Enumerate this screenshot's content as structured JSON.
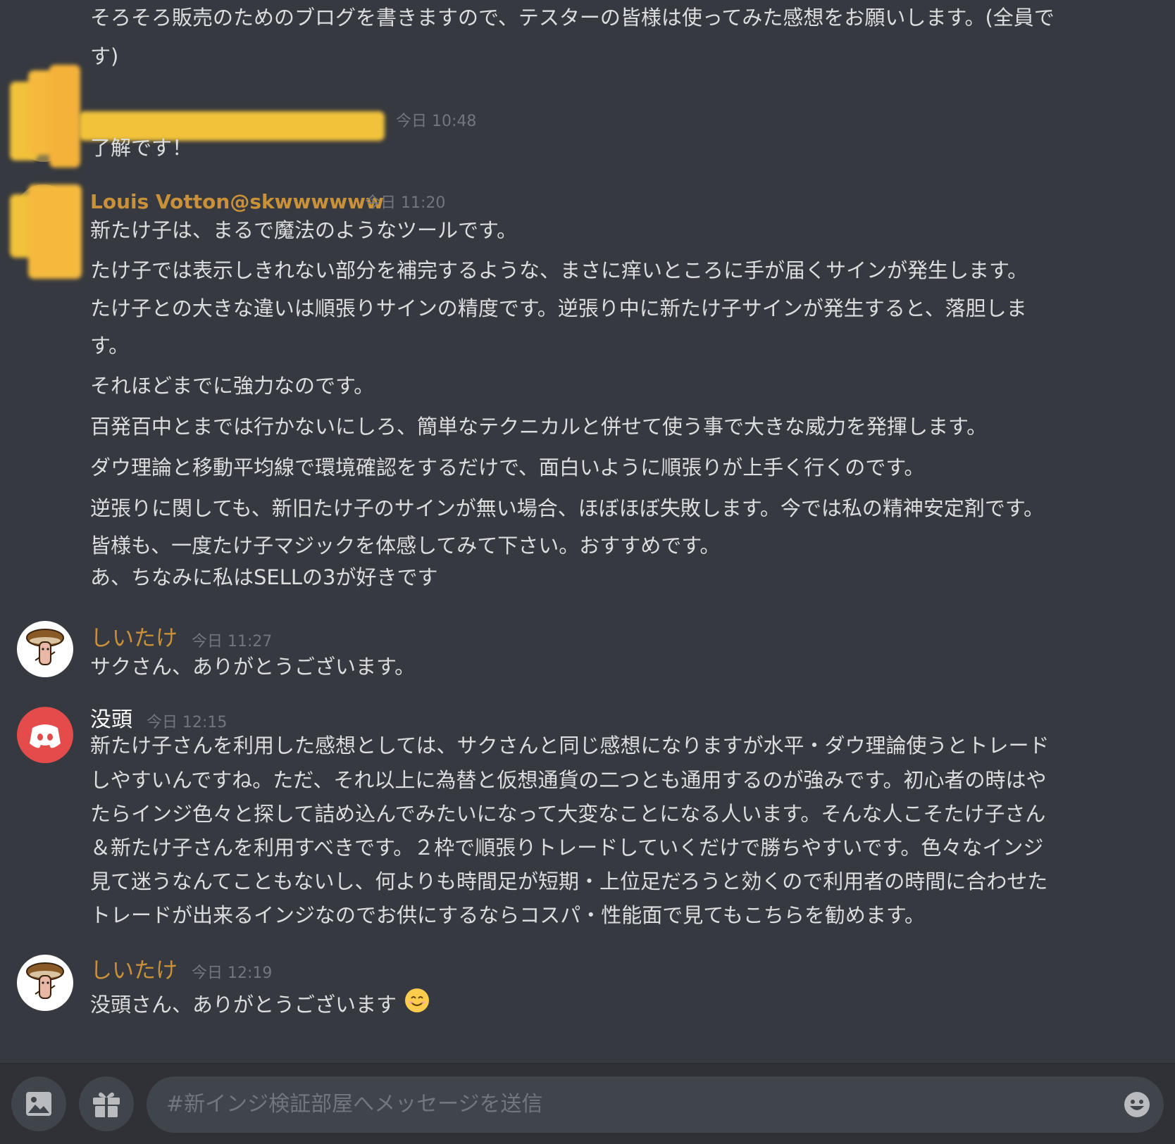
{
  "colors": {
    "background": "#36393f",
    "text": "#dcddde",
    "timestamp": "#72767d",
    "author_orange": "#c9913a",
    "discord_red": "#e44b4b",
    "input_bg": "#40444b",
    "bar_bg": "#2f3136"
  },
  "messages": {
    "m0": {
      "lines": [
        "そろそろ販売のためのブログを書きますので、テスターの皆様は使ってみた感想をお願いします。(全員で",
        "す)"
      ]
    },
    "m1": {
      "timestamp": "今日 10:48",
      "lines": [
        "了解です！"
      ]
    },
    "m2": {
      "author": "Louis Votton@skwwwwww",
      "timestamp": "今日 11:20",
      "lines": [
        "新たけ子は、まるで魔法のようなツールです。",
        "たけ子では表示しきれない部分を補完するような、まさに痒いところに手が届くサインが発生します。",
        "たけ子との大きな違いは順張りサインの精度です。逆張り中に新たけ子サインが発生すると、落胆しま",
        "す。",
        "それほどまでに強力なのです。",
        "百発百中とまでは行かないにしろ、簡単なテクニカルと併せて使う事で大きな威力を発揮します。",
        "ダウ理論と移動平均線で環境確認をするだけで、面白いように順張りが上手く行くのです。",
        "逆張りに関しても、新旧たけ子のサインが無い場合、ほぼほぼ失敗します。今では私の精神安定剤です。",
        "皆様も、一度たけ子マジックを体感してみて下さい。おすすめです。",
        "あ、ちなみに私はSELLの3が好きです"
      ]
    },
    "m3": {
      "author": "しいたけ",
      "timestamp": "今日 11:27",
      "lines": [
        "サクさん、ありがとうございます。"
      ]
    },
    "m4": {
      "author": "没頭",
      "timestamp": "今日 12:15",
      "lines": [
        "新たけ子さんを利用した感想としては、サクさんと同じ感想になりますが水平・ダウ理論使うとトレード",
        "しやすいんですね。ただ、それ以上に為替と仮想通貨の二つとも通用するのが強みです。初心者の時はや",
        "たらインジ色々と探して詰め込んでみたいになって大変なことになる人います。そんな人こそたけ子さん",
        "＆新たけ子さんを利用すべきです。２枠で順張りトレードしていくだけで勝ちやすいです。色々なインジ",
        "見て迷うなんてこともないし、何よりも時間足が短期・上位足だろうと効くので利用者の時間に合わせた",
        "トレードが出来るインジなのでお供にするならコスパ・性能面で見てもこちらを勧めます。"
      ]
    },
    "m5": {
      "author": "しいたけ",
      "timestamp": "今日 12:19",
      "text": "没頭さん、ありがとうございます",
      "emoji": "smiling-face-icon"
    }
  },
  "input": {
    "placeholder": "#新インジ検証部屋へメッセージを送信"
  },
  "icons": {
    "image": "image-icon",
    "gift": "gift-icon",
    "emoji": "emoji-picker-icon"
  }
}
